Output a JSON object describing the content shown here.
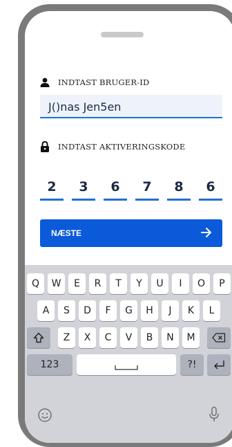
{
  "form": {
    "userid_label": "INDTAST BRUGER-ID",
    "userid_value": "J()nas Jen5en",
    "code_label": "INDTAST AKTIVERINGSKODE",
    "code_digits": [
      "2",
      "3",
      "6",
      "7",
      "8",
      "6"
    ],
    "next_label": "NÆSTE"
  },
  "keyboard": {
    "row1": [
      "Q",
      "W",
      "E",
      "R",
      "T",
      "Y",
      "U",
      "I",
      "O",
      "P"
    ],
    "row2": [
      "A",
      "S",
      "D",
      "F",
      "G",
      "H",
      "J",
      "K",
      "L"
    ],
    "row3": [
      "Z",
      "X",
      "C",
      "V",
      "B",
      "N",
      "M"
    ],
    "numbers_key": "123",
    "symbols_key": "?!"
  },
  "icons": {
    "user": "user-icon",
    "lock": "lock-icon",
    "arrow": "arrow-right-icon",
    "shift": "shift-icon",
    "backspace": "backspace-icon",
    "space": "space-icon",
    "return": "return-icon",
    "emoji": "emoji-icon",
    "mic": "microphone-icon"
  },
  "colors": {
    "accent": "#0b5ad9",
    "underline": "#1f6fd6",
    "keyboard_bg": "#d1d3d9"
  }
}
